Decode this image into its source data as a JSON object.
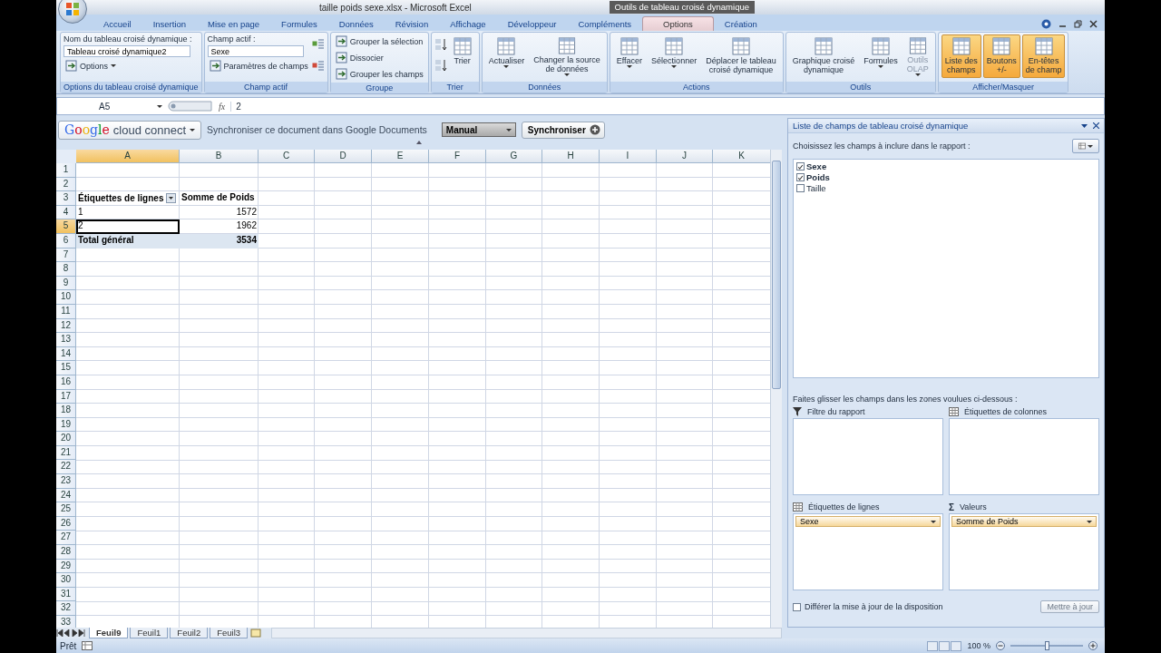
{
  "window": {
    "title": "taille poids sexe.xlsx - Microsoft Excel",
    "context_title": "Outils de tableau croisé dynamique"
  },
  "tabs": [
    {
      "label": "Accueil",
      "selected": false
    },
    {
      "label": "Insertion",
      "selected": false
    },
    {
      "label": "Mise en page",
      "selected": false
    },
    {
      "label": "Formules",
      "selected": false
    },
    {
      "label": "Données",
      "selected": false
    },
    {
      "label": "Révision",
      "selected": false
    },
    {
      "label": "Affichage",
      "selected": false
    },
    {
      "label": "Développeur",
      "selected": false
    },
    {
      "label": "Compléments",
      "selected": false
    },
    {
      "label": "Options",
      "selected": true
    },
    {
      "label": "Création",
      "selected": false
    }
  ],
  "ribbon": [
    {
      "kind": "form",
      "name": "Options du tableau croisé dynamique",
      "label": "Nom du tableau croisé dynamique :",
      "value": "Tableau croisé dynamique2",
      "expand_buttons": false,
      "items": [
        {
          "label": "Options",
          "caret": true
        }
      ]
    },
    {
      "kind": "form",
      "name": "Champ actif",
      "label": "Champ actif :",
      "value": "Sexe",
      "expand_buttons": true,
      "items": [
        {
          "label": "Paramètres de champs",
          "caret": false
        }
      ]
    },
    {
      "kind": "list",
      "name": "Groupe",
      "items": [
        {
          "label": "Grouper la sélection"
        },
        {
          "label": "Dissocier"
        },
        {
          "label": "Grouper les champs"
        }
      ]
    },
    {
      "kind": "sort",
      "name": "Trier",
      "items": [
        {
          "label": "Trier",
          "caret": false,
          "selected": false,
          "disabled": false
        }
      ]
    },
    {
      "kind": "large",
      "name": "Données",
      "items": [
        {
          "label": "Actualiser",
          "caret": true,
          "selected": false,
          "disabled": false
        },
        {
          "label": "Changer la source\nde données",
          "caret": true,
          "selected": false,
          "disabled": false
        }
      ]
    },
    {
      "kind": "large",
      "name": "Actions",
      "items": [
        {
          "label": "Effacer",
          "caret": true,
          "selected": false,
          "disabled": false
        },
        {
          "label": "Sélectionner",
          "caret": true,
          "selected": false,
          "disabled": false
        },
        {
          "label": "Déplacer le tableau\ncroisé dynamique",
          "caret": false,
          "selected": false,
          "disabled": false
        }
      ]
    },
    {
      "kind": "large",
      "name": "Outils",
      "items": [
        {
          "label": "Graphique croisé\ndynamique",
          "caret": false,
          "selected": false,
          "disabled": false
        },
        {
          "label": "Formules",
          "caret": true,
          "selected": false,
          "disabled": false
        },
        {
          "label": "Outils\nOLAP",
          "caret": true,
          "selected": false,
          "disabled": true
        }
      ]
    },
    {
      "kind": "large",
      "name": "Afficher/Masquer",
      "items": [
        {
          "label": "Liste des\nchamps",
          "caret": false,
          "selected": true,
          "disabled": false
        },
        {
          "label": "Boutons\n+/-",
          "caret": false,
          "selected": true,
          "disabled": false
        },
        {
          "label": "En-têtes\nde champ",
          "caret": false,
          "selected": true,
          "disabled": false
        }
      ]
    }
  ],
  "formula_bar": {
    "name_box": "A5",
    "fx": "fx",
    "value": "2"
  },
  "cloud_bar": {
    "brand": "Google",
    "product": "cloud connect",
    "message": "Synchroniser ce document dans Google Documents",
    "mode": "Manual",
    "sync_button": "Synchroniser"
  },
  "sheet": {
    "columns": [
      {
        "label": "A",
        "selected": true
      },
      {
        "label": "B",
        "selected": false
      },
      {
        "label": "C",
        "selected": false
      },
      {
        "label": "D",
        "selected": false
      },
      {
        "label": "E",
        "selected": false
      },
      {
        "label": "F",
        "selected": false
      },
      {
        "label": "G",
        "selected": false
      },
      {
        "label": "H",
        "selected": false
      },
      {
        "label": "I",
        "selected": false
      },
      {
        "label": "J",
        "selected": false
      },
      {
        "label": "K",
        "selected": false
      }
    ],
    "rows": [
      {
        "label": "1",
        "kind": "blank",
        "selected": false
      },
      {
        "label": "2",
        "kind": "blank",
        "selected": false
      },
      {
        "label": "3",
        "kind": "header",
        "selected": false,
        "cells": [
          "Étiquettes de lignes",
          "Somme de Poids"
        ]
      },
      {
        "label": "4",
        "kind": "item",
        "selected": false,
        "cells": [
          "1",
          "1572"
        ]
      },
      {
        "label": "5",
        "kind": "item",
        "selected": true,
        "cells": [
          "2",
          "1962"
        ]
      },
      {
        "label": "6",
        "kind": "total",
        "selected": false,
        "cells": [
          "Total général",
          "3534"
        ]
      },
      {
        "label": "7",
        "kind": "blank",
        "selected": false
      },
      {
        "label": "8",
        "kind": "blank",
        "selected": false
      },
      {
        "label": "9",
        "kind": "blank",
        "selected": false
      },
      {
        "label": "10",
        "kind": "blank",
        "selected": false
      },
      {
        "label": "11",
        "kind": "blank",
        "selected": false
      },
      {
        "label": "12",
        "kind": "blank",
        "selected": false
      },
      {
        "label": "13",
        "kind": "blank",
        "selected": false
      },
      {
        "label": "14",
        "kind": "blank",
        "selected": false
      },
      {
        "label": "15",
        "kind": "blank",
        "selected": false
      },
      {
        "label": "16",
        "kind": "blank",
        "selected": false
      },
      {
        "label": "17",
        "kind": "blank",
        "selected": false
      },
      {
        "label": "18",
        "kind": "blank",
        "selected": false
      },
      {
        "label": "19",
        "kind": "blank",
        "selected": false
      },
      {
        "label": "20",
        "kind": "blank",
        "selected": false
      },
      {
        "label": "21",
        "kind": "blank",
        "selected": false
      },
      {
        "label": "22",
        "kind": "blank",
        "selected": false
      },
      {
        "label": "23",
        "kind": "blank",
        "selected": false
      },
      {
        "label": "24",
        "kind": "blank",
        "selected": false
      },
      {
        "label": "25",
        "kind": "blank",
        "selected": false
      },
      {
        "label": "26",
        "kind": "blank",
        "selected": false
      },
      {
        "label": "27",
        "kind": "blank",
        "selected": false
      },
      {
        "label": "28",
        "kind": "blank",
        "selected": false
      },
      {
        "label": "29",
        "kind": "blank",
        "selected": false
      },
      {
        "label": "30",
        "kind": "blank",
        "selected": false
      },
      {
        "label": "31",
        "kind": "blank",
        "selected": false
      },
      {
        "label": "32",
        "kind": "blank",
        "selected": false
      },
      {
        "label": "33",
        "kind": "blank",
        "selected": false
      }
    ]
  },
  "sheet_tabs": [
    {
      "label": "Feuil9",
      "selected": true
    },
    {
      "label": "Feuil1",
      "selected": false
    },
    {
      "label": "Feuil2",
      "selected": false
    },
    {
      "label": "Feuil3",
      "selected": false
    }
  ],
  "field_list": {
    "title": "Liste de champs de tableau croisé dynamique",
    "prompt": "Choisissez les champs à inclure dans le rapport :",
    "fields": [
      {
        "label": "Sexe",
        "checked": true
      },
      {
        "label": "Poids",
        "checked": true
      },
      {
        "label": "Taille",
        "checked": false
      }
    ],
    "instruction": "Faites glisser les champs dans les zones voulues ci-dessous :",
    "areas": [
      {
        "kind": "filter",
        "label": "Filtre du rapport"
      },
      {
        "kind": "columns",
        "label": "Étiquettes de colonnes"
      },
      {
        "kind": "rows",
        "label": "Étiquettes de lignes",
        "items": [
          "Sexe"
        ]
      },
      {
        "kind": "values",
        "symbol": "Σ",
        "label": "Valeurs",
        "items": [
          "Somme de Poids"
        ]
      }
    ],
    "defer": {
      "label": "Différer la mise à jour de la disposition",
      "checked": false
    },
    "update_button": {
      "label": "Mettre à jour",
      "disabled": true
    }
  },
  "status_bar": {
    "text": "Prêt",
    "zoom": "100 %",
    "zoom_slider": {
      "level": 0.5
    }
  }
}
